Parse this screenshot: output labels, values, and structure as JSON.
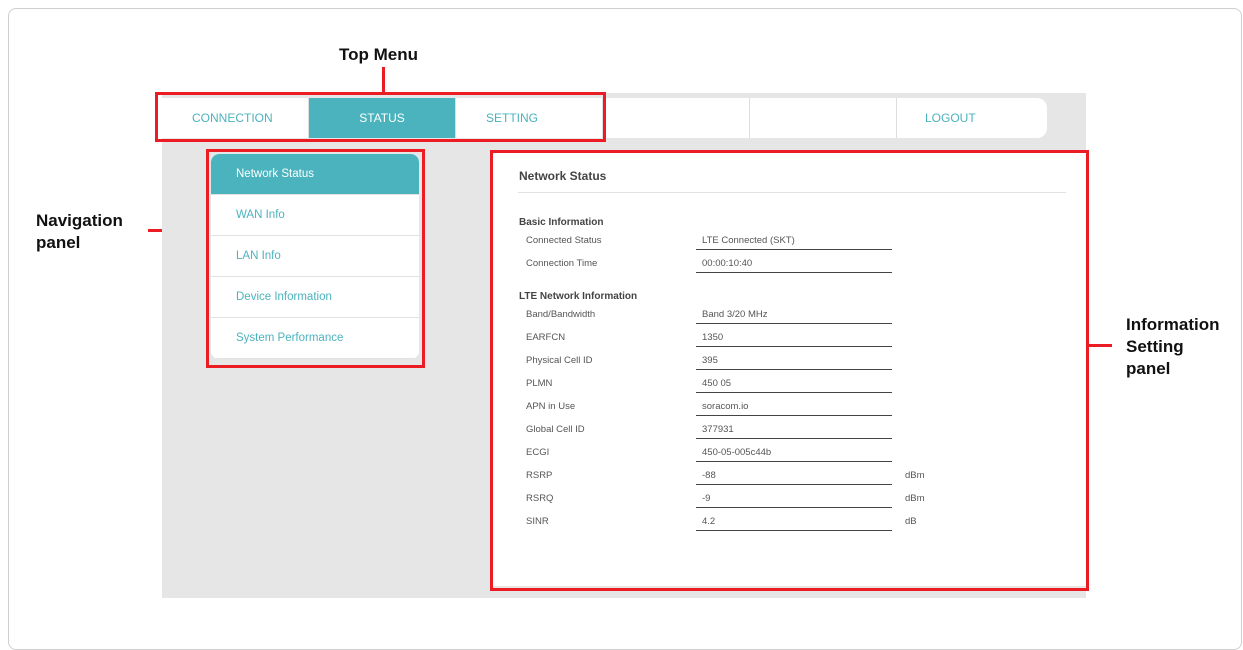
{
  "annotations": {
    "top_menu": "Top Menu",
    "navigation_panel": "Navigation\npanel",
    "information_panel": "Information\nSetting\npanel"
  },
  "topmenu": {
    "items": [
      "CONNECTION",
      "STATUS",
      "SETTING",
      "",
      "",
      "LOGOUT"
    ],
    "active": "STATUS"
  },
  "nav": {
    "items": [
      "Network Status",
      "WAN Info",
      "LAN Info",
      "Device Information",
      "System Performance"
    ],
    "active": "Network Status"
  },
  "info": {
    "title": "Network Status",
    "basic": {
      "title": "Basic Information",
      "rows": [
        {
          "label": "Connected Status",
          "value": "LTE Connected (SKT)",
          "unit": ""
        },
        {
          "label": "Connection Time",
          "value": "00:00:10:40",
          "unit": ""
        }
      ]
    },
    "lte": {
      "title": "LTE Network Information",
      "rows": [
        {
          "label": "Band/Bandwidth",
          "value": "Band 3/20 MHz",
          "unit": ""
        },
        {
          "label": "EARFCN",
          "value": "1350",
          "unit": ""
        },
        {
          "label": "Physical Cell ID",
          "value": "395",
          "unit": ""
        },
        {
          "label": "PLMN",
          "value": "450 05",
          "unit": ""
        },
        {
          "label": "APN in Use",
          "value": "soracom.io",
          "unit": ""
        },
        {
          "label": "Global Cell ID",
          "value": "377931",
          "unit": ""
        },
        {
          "label": "ECGI",
          "value": "450-05-005c44b",
          "unit": ""
        },
        {
          "label": "RSRP",
          "value": "-88",
          "unit": "dBm"
        },
        {
          "label": "RSRQ",
          "value": "-9",
          "unit": "dBm"
        },
        {
          "label": "SINR",
          "value": "4.2",
          "unit": "dB"
        }
      ]
    }
  },
  "colors": {
    "accent": "#4ab3bd",
    "annotation_red": "#ec1c24",
    "panel_bg": "#e6e6e6"
  }
}
